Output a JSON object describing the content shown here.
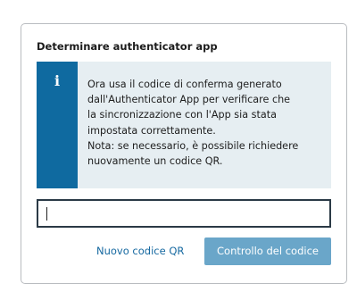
{
  "dialog": {
    "title": "Determinare authenticator app"
  },
  "info": {
    "icon": "info-icon",
    "icon_glyph": "i",
    "accent_color": "#0f6aa0",
    "background_color": "#e6eef2",
    "lines": [
      "Ora usa il codice di conferma generato",
      "dall'Authenticator App per verificare che",
      "la sincronizzazione con l'App sia stata",
      "impostata correttamente.",
      "Nota: se necessario, è possibile richiedere",
      "nuovamente un codice QR."
    ]
  },
  "code_input": {
    "value": "",
    "placeholder": ""
  },
  "actions": {
    "new_qr_label": "Nuovo codice QR",
    "check_code_label": "Controllo del codice",
    "primary_color": "#6aa6c9",
    "link_color": "#1568a0"
  }
}
